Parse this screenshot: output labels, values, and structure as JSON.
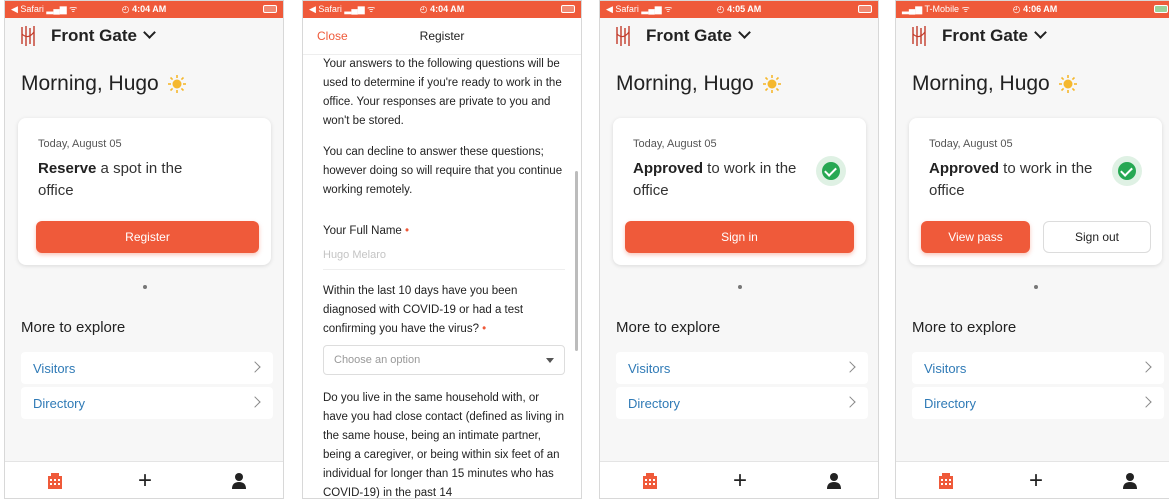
{
  "statusbars": [
    {
      "left": "◀ Safari ▂▄▆ ᯤ",
      "time": "◴ 4:04 AM"
    },
    {
      "left": "◀ Safari ▂▄▆ ᯤ",
      "time": "◴ 4:04 AM"
    },
    {
      "left": "◀ Safari ▂▄▆ ᯤ",
      "time": "◴ 4:05 AM"
    },
    {
      "left": "▂▄▆ T-Mobile ᯤ",
      "time": "◴ 4:06 AM"
    }
  ],
  "home": {
    "location": "Front Gate",
    "greeting": "Morning, Hugo",
    "date": "Today, August 05",
    "reserve_bold": "Reserve",
    "reserve_rest": " a spot in the office",
    "approved_bold": "Approved",
    "approved_rest": " to work in the office",
    "register_button": "Register",
    "signin_button": "Sign in",
    "viewpass_button": "View pass",
    "signout_button": "Sign out",
    "more_title": "More to explore",
    "explore_items": [
      "Visitors",
      "Directory"
    ]
  },
  "register": {
    "close": "Close",
    "title": "Register",
    "intro1": "Your answers to the following questions will be used to determine if you're ready to work in the office. Your responses are private to you and won't be stored.",
    "intro2": "You can decline to answer these questions; however doing so will require that you continue working remotely.",
    "name_label": "Your Full Name",
    "required_mark": "•",
    "name_value": "Hugo Melaro",
    "q1": "Within the last 10 days have you been diagnosed with COVID-19 or had a test confirming you have the virus?",
    "select_placeholder": "Choose an option",
    "q2": "Do you live in the same household with, or have you had close contact (defined as living in the same house, being an intimate partner, being a caregiver, or being within six feet of an individual for longer than 15 minutes who has COVID-19) in the past 14"
  },
  "colors": {
    "accent": "#ef5a3a",
    "link": "#2f7ab6",
    "success": "#27a853"
  }
}
